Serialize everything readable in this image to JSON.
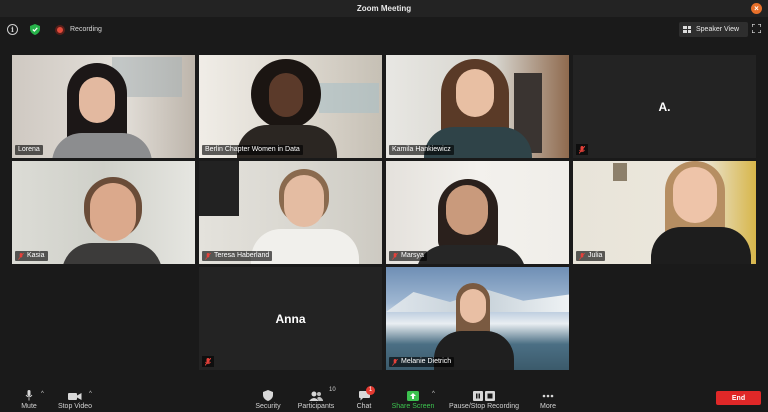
{
  "window": {
    "title": "Zoom Meeting"
  },
  "topbar": {
    "recording_label": "Recording",
    "view_label": "Speaker View"
  },
  "participants": [
    {
      "name": "Lorena",
      "muted": false,
      "video": true
    },
    {
      "name": "Berlin Chapter Women in Data",
      "muted": false,
      "video": true,
      "active_speaker": true
    },
    {
      "name": "Kamila Hankiewicz",
      "muted": false,
      "video": true
    },
    {
      "name": "A.",
      "muted": true,
      "video": false
    },
    {
      "name": "Kasia",
      "muted": true,
      "video": true
    },
    {
      "name": "Teresa Haberland",
      "muted": true,
      "video": true
    },
    {
      "name": "Marsya",
      "muted": true,
      "video": true
    },
    {
      "name": "Julia",
      "muted": true,
      "video": true
    },
    {
      "name": "Anna",
      "muted": true,
      "video": false
    },
    {
      "name": "Melanie Dietrich",
      "muted": true,
      "video": true
    }
  ],
  "toolbar": {
    "mute_label": "Mute",
    "stop_video_label": "Stop Video",
    "security_label": "Security",
    "participants_label": "Participants",
    "participants_count": "10",
    "chat_label": "Chat",
    "chat_badge": "1",
    "share_label": "Share Screen",
    "record_label": "Pause/Stop Recording",
    "more_label": "More",
    "end_label": "End"
  },
  "colors": {
    "active_border": "#4ac45e",
    "end_button": "#e02828",
    "share_green": "#3cc24f",
    "record_red": "#e24b3b"
  }
}
